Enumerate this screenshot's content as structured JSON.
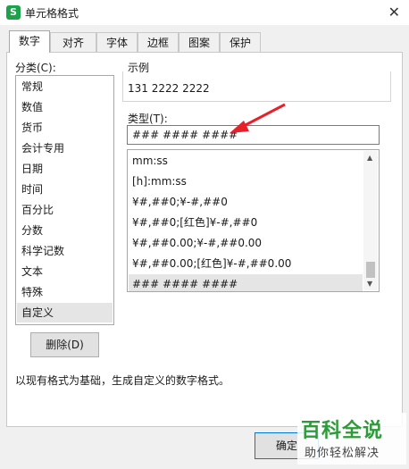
{
  "window": {
    "title": "单元格格式",
    "app_icon_glyph": "S"
  },
  "tabs": [
    {
      "label": "数字"
    },
    {
      "label": "对齐"
    },
    {
      "label": "字体"
    },
    {
      "label": "边框"
    },
    {
      "label": "图案"
    },
    {
      "label": "保护"
    }
  ],
  "category": {
    "label": "分类(C):",
    "items": [
      "常规",
      "数值",
      "货币",
      "会计专用",
      "日期",
      "时间",
      "百分比",
      "分数",
      "科学记数",
      "文本",
      "特殊",
      "自定义"
    ],
    "selected": "自定义"
  },
  "preview": {
    "label": "示例",
    "value": "131 2222 2222"
  },
  "type_field": {
    "label": "类型(T):",
    "value": "### #### ####"
  },
  "format_list": {
    "items": [
      "mm:ss",
      "[h]:mm:ss",
      "¥#,##0;¥-#,##0",
      "¥#,##0;[红色]¥-#,##0",
      "¥#,##0.00;¥-#,##0.00",
      "¥#,##0.00;[红色]¥-#,##0.00",
      "### #### ####"
    ],
    "selected": "### #### ####"
  },
  "buttons": {
    "delete": "删除(D)",
    "ok": "确定"
  },
  "description": "以现有格式为基础，生成自定义的数字格式。",
  "watermark": {
    "main": "百科全说",
    "sub": "助你轻松解决"
  },
  "colors": {
    "arrow": "#e8202a",
    "watermark_green": "#2e9a3a",
    "selection": "#e5e5e5"
  }
}
